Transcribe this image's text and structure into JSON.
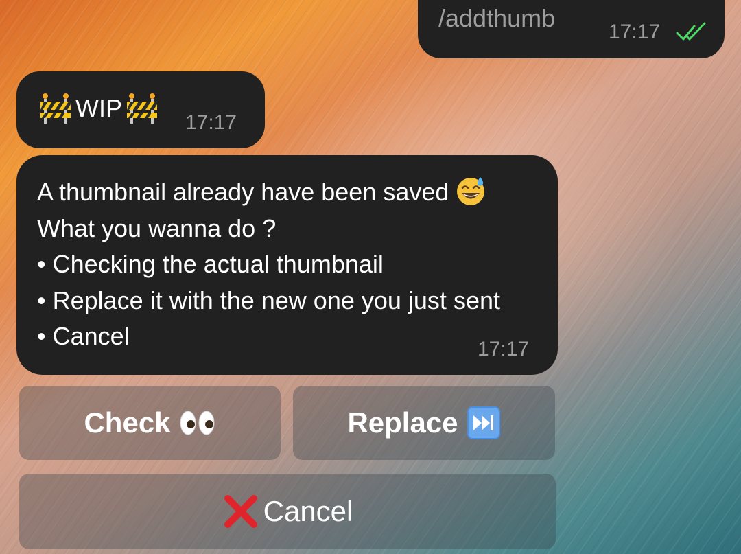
{
  "messages": {
    "outgoing": {
      "text": "/addthumb",
      "time": "17:17",
      "status_icon": "double-check-icon",
      "status_color": "#4cd964"
    },
    "wip": {
      "label": "WIP",
      "time": "17:17",
      "icon": "construction-barrier-icon"
    },
    "prompt": {
      "lines": [
        "A thumbnail already have been saved",
        "What you wanna do ?",
        "• Checking the actual thumbnail",
        "• Replace it with the new one you just sent",
        "• Cancel"
      ],
      "emoji": "grinning-sweat-icon",
      "time": "17:17"
    }
  },
  "keyboard": {
    "check": {
      "label": "Check",
      "icon": "eyes-icon"
    },
    "replace": {
      "label": "Replace",
      "icon": "fast-forward-icon"
    },
    "cancel": {
      "label": "Cancel",
      "icon": "cross-mark-icon"
    }
  },
  "colors": {
    "bubble": "#212121",
    "meta_text": "#9e9e9e",
    "button_bg": "rgba(60,70,80,0.38)",
    "cancel_x": "#e0242b",
    "ff_icon": "#4a90e2"
  }
}
